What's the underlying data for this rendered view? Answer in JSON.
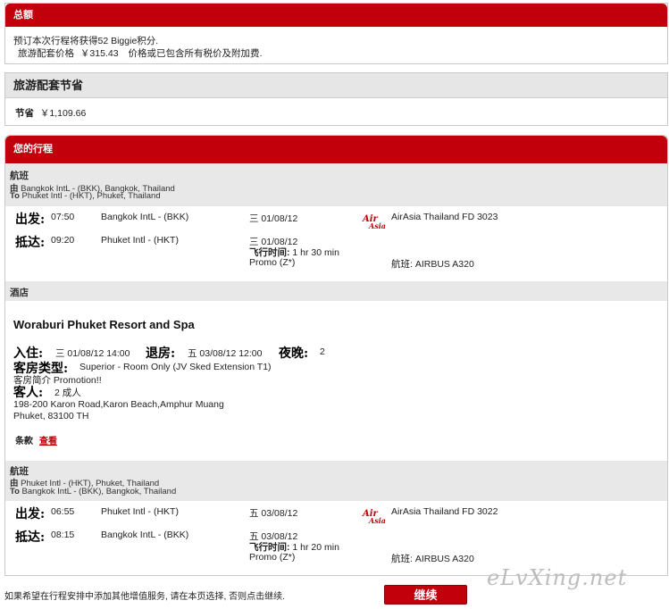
{
  "summary": {
    "title": "总额",
    "points_line": "预订本次行程将获得52 Biggie积分.",
    "price_label": "旅游配套价格",
    "price_value": "￥315.43",
    "price_note": "价格或已包含所有税价及附加费."
  },
  "savings": {
    "title": "旅游配套节省",
    "label": "节省",
    "value": "￥1,109.66"
  },
  "itinerary": {
    "title": "您的行程",
    "outbound": {
      "section_label": "航班",
      "from_label": "由",
      "from_value": "Bangkok IntL - (BKK), Bangkok, Thailand",
      "to_label": "To",
      "to_value": "Phuket Intl - (HKT), Phuket, Thailand",
      "depart_label": "出发:",
      "depart_time": "07:50",
      "depart_airport": "Bangkok IntL - (BKK)",
      "depart_date": "三 01/08/12",
      "arrive_label": "抵达:",
      "arrive_time": "09:20",
      "arrive_airport": "Phuket Intl - (HKT)",
      "arrive_date": "三 01/08/12",
      "duration_label": "飞行时间:",
      "duration_value": "1 hr 30 min",
      "fare": "Promo (Z*)",
      "airline_logo": "AirAsia",
      "flight": "AirAsia Thailand FD  3023",
      "aircraft": "航班: AIRBUS A320"
    },
    "hotel": {
      "section_label": "酒店",
      "name": "Woraburi Phuket Resort and Spa",
      "checkin_label": "入住:",
      "checkin_value": "三 01/08/12 14:00",
      "checkout_label": "退房:",
      "checkout_value": "五 03/08/12 12:00",
      "nights_label": "夜晚:",
      "nights_value": "2",
      "room_label": "客房类型:",
      "room_value": "Superior - Room Only (JV Sked Extension T1)",
      "room_desc": "客房简介 Promotion!!",
      "guests_label": "客人:",
      "guests_value": "2 成人",
      "address1": "198-200 Karon Road,Karon Beach,Amphur Muang",
      "address2": "Phuket, 83100 TH",
      "terms_label": "条款",
      "terms_link": "查看"
    },
    "return": {
      "section_label": "航班",
      "from_label": "由",
      "from_value": "Phuket Intl - (HKT), Phuket, Thailand",
      "to_label": "To",
      "to_value": "Bangkok IntL - (BKK), Bangkok, Thailand",
      "depart_label": "出发:",
      "depart_time": "06:55",
      "depart_airport": "Phuket Intl - (HKT)",
      "depart_date": "五 03/08/12",
      "arrive_label": "抵达:",
      "arrive_time": "08:15",
      "arrive_airport": "Bangkok IntL - (BKK)",
      "arrive_date": "五 03/08/12",
      "duration_label": "飞行时间:",
      "duration_value": "1 hr 20 min",
      "fare": "Promo (Z*)",
      "airline_logo": "AirAsia",
      "flight": "AirAsia Thailand FD  3022",
      "aircraft": "航班: AIRBUS A320"
    }
  },
  "footer": {
    "note": "如果希望在行程安排中添加其他增值服务, 请在本页选择, 否则点击继续.",
    "continue_label": "继续",
    "watermark": "eLvXing.net"
  },
  "colors": {
    "brand_red": "#c1000b",
    "section_gray": "#e8e8e8"
  }
}
